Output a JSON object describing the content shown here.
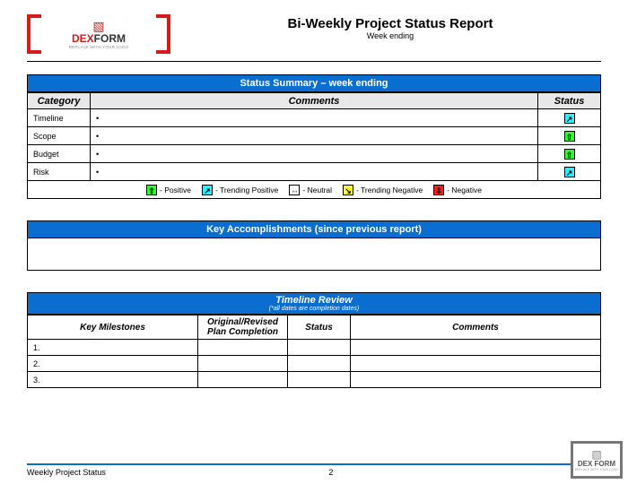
{
  "logo": {
    "brand_part1": "DEX",
    "brand_part2": "FORM",
    "tagline": "REPLACE WITH YOUR LOGO"
  },
  "header": {
    "title": "Bi-Weekly Project Status Report",
    "subtitle": "Week ending"
  },
  "summary": {
    "banner": "Status Summary – week ending",
    "col_category": "Category",
    "col_comments": "Comments",
    "col_status": "Status",
    "rows": [
      {
        "cat": "Timeline",
        "comment": "•",
        "status_color": "cyan",
        "status_glyph": "↗"
      },
      {
        "cat": "Scope",
        "comment": "•",
        "status_color": "green",
        "status_glyph": "⇧"
      },
      {
        "cat": "Budget",
        "comment": "•",
        "status_color": "green",
        "status_glyph": "⇧"
      },
      {
        "cat": "Risk",
        "comment": "•",
        "status_color": "cyan",
        "status_glyph": "↗"
      }
    ],
    "legend": [
      {
        "color": "green",
        "glyph": "⇧",
        "label": "- Positive"
      },
      {
        "color": "cyan",
        "glyph": "↗",
        "label": "- Trending Positive"
      },
      {
        "color": "white",
        "glyph": "⇔",
        "label": "- Neutral"
      },
      {
        "color": "yellow",
        "glyph": "↘",
        "label": "- Trending Negative"
      },
      {
        "color": "red",
        "glyph": "⇩",
        "label": "- Negative"
      }
    ]
  },
  "accomplishments": {
    "banner": "Key Accomplishments (since previous report)"
  },
  "timeline": {
    "banner": "Timeline Review",
    "sub": "(*all dates are completion dates)",
    "col_milestones": "Key Milestones",
    "col_plan": "Original/Revised Plan Completion",
    "col_status": "Status",
    "col_comments": "Comments",
    "rows": [
      {
        "n": "1."
      },
      {
        "n": "2."
      },
      {
        "n": "3."
      }
    ]
  },
  "footer": {
    "left": "Weekly Project Status",
    "page": "2"
  },
  "corner": {
    "brand": "DEX FORM",
    "tag": "REPLACE WITH YOUR LOGO"
  }
}
